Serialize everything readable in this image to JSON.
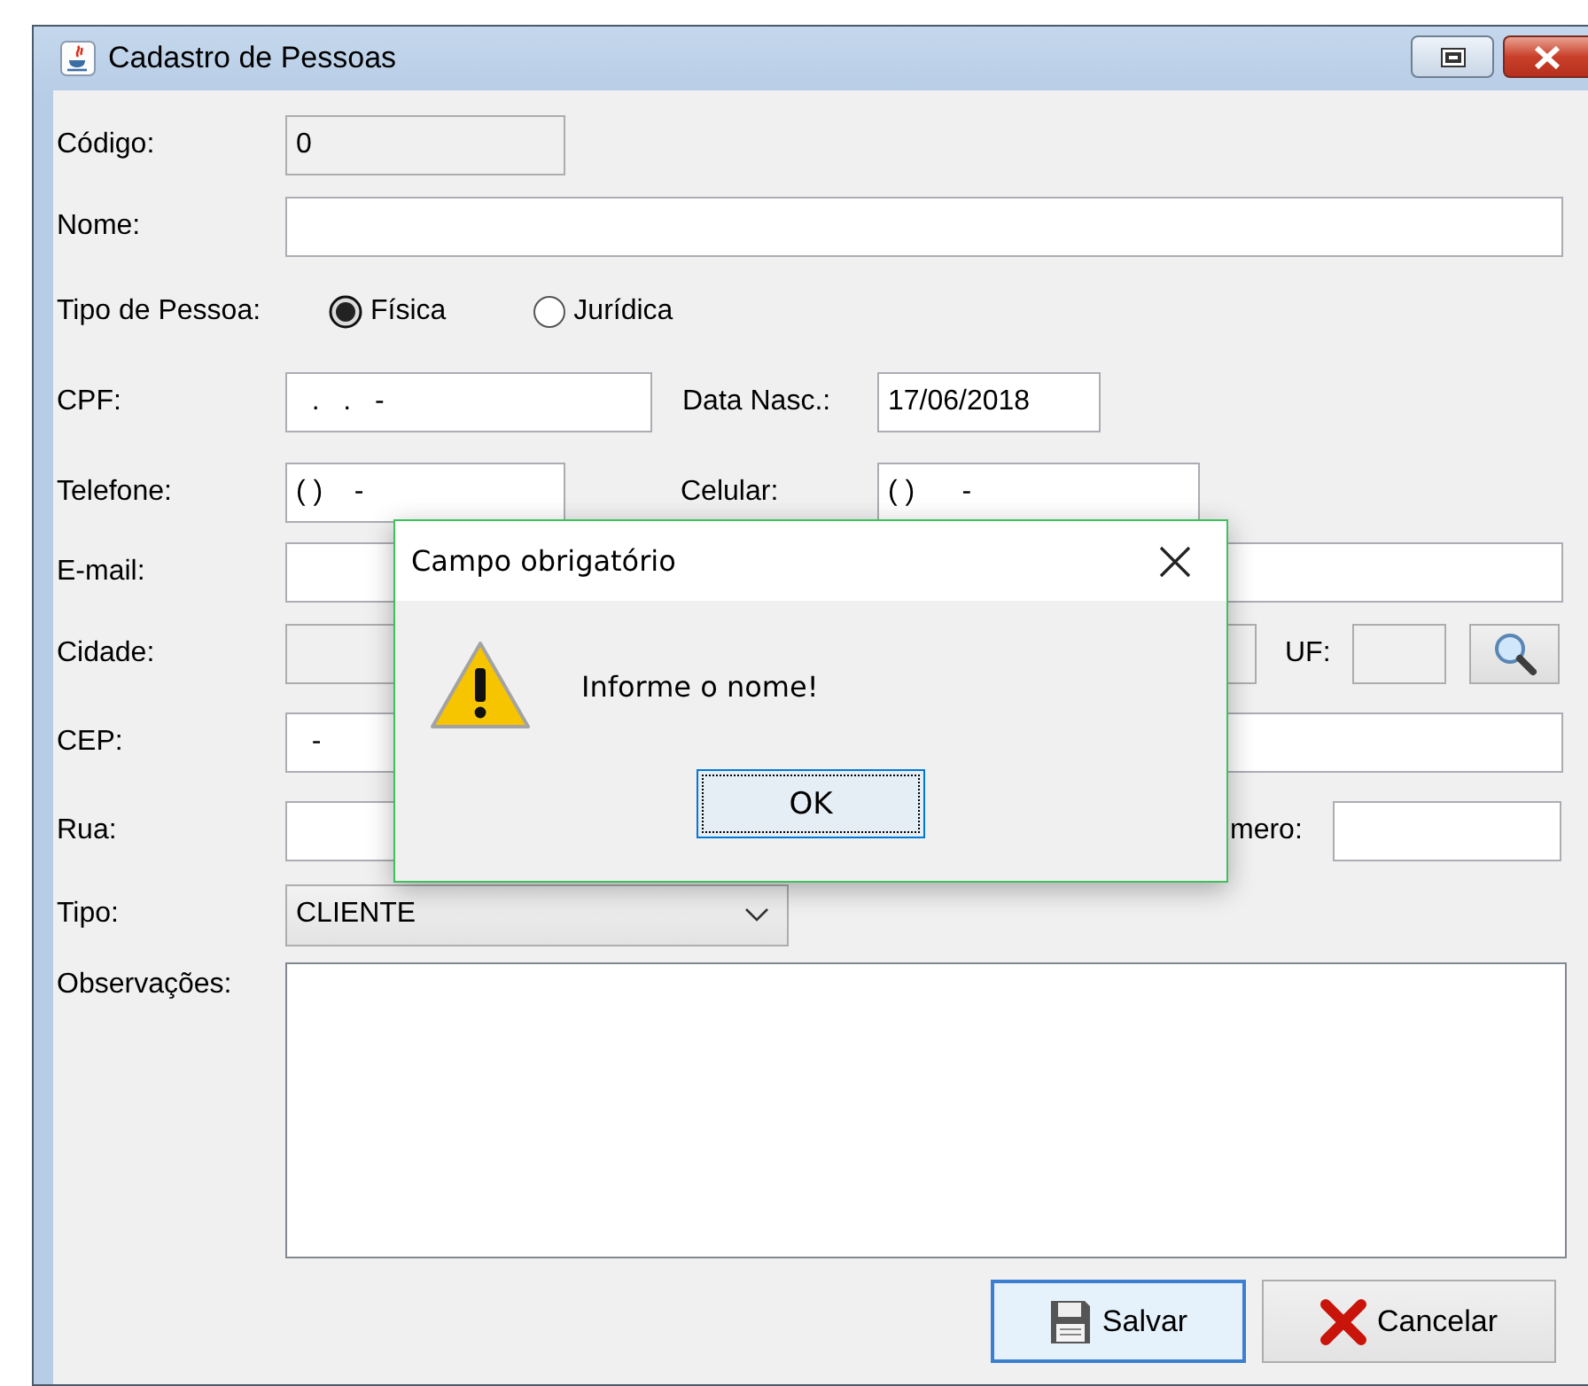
{
  "window": {
    "title": "Cadastro de Pessoas"
  },
  "form": {
    "codigo": {
      "label": "Código:",
      "value": "0",
      "disabled": true
    },
    "nome": {
      "label": "Nome:",
      "disabled": false
    },
    "tipo_pessoa": {
      "label": "Tipo de Pessoa:",
      "options": [
        {
          "label": "Física",
          "selected": true
        },
        {
          "label": "Jurídica",
          "selected": false
        }
      ]
    },
    "cpf": {
      "label": "CPF:",
      "value": "  .   .   -",
      "disabled": false
    },
    "data_nasc": {
      "label": "Data Nasc.:",
      "value": "17/06/2018",
      "disabled": false
    },
    "telefone": {
      "label": "Telefone:",
      "value": "( )    -",
      "disabled": false
    },
    "celular": {
      "label": "Celular:",
      "value": "( )      -",
      "disabled": false
    },
    "email": {
      "label": "E-mail:",
      "disabled": false
    },
    "cidade": {
      "label": "Cidade:",
      "disabled": true
    },
    "uf": {
      "label": "UF:",
      "disabled": true
    },
    "cep": {
      "label": "CEP:",
      "value": "  -",
      "disabled": false
    },
    "rua": {
      "label": "Rua:",
      "disabled": false
    },
    "numero": {
      "label": "mero:",
      "disabled": false
    },
    "tipo": {
      "label": "Tipo:",
      "value": "CLIENTE"
    },
    "observacoes": {
      "label": "Observações:"
    }
  },
  "buttons": [
    {
      "label": "Salvar",
      "kind": "save",
      "focused": true
    },
    {
      "label": "Cancelar",
      "kind": "cancel",
      "focused": false
    }
  ],
  "dialog": {
    "title": "Campo obrigatório",
    "message": "Informe o nome!",
    "button": "OK"
  }
}
